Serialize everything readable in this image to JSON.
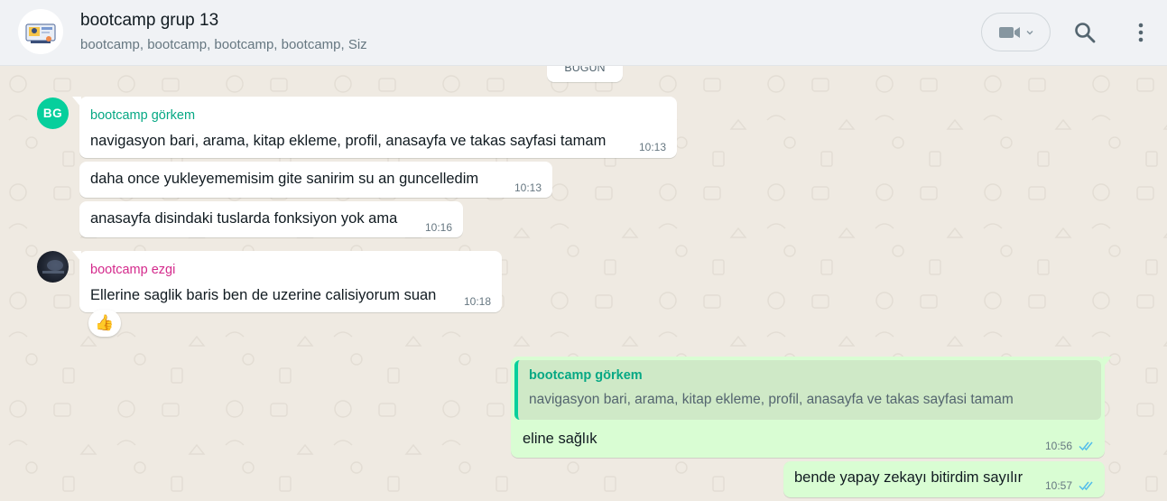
{
  "header": {
    "title": "bootcamp grup 13",
    "members": "bootcamp, bootcamp, bootcamp, bootcamp, Siz",
    "icons": [
      "group-avatar",
      "video-call-icon",
      "chevron-down-icon",
      "search-icon",
      "menu-icon"
    ]
  },
  "date_divider": "BUGÜN",
  "messages": [
    {
      "sender": "bootcamp görkem",
      "avatar_initials": "BG",
      "text": "navigasyon bari, arama, kitap ekleme, profil, anasayfa ve takas sayfasi tamam",
      "time": "10:13"
    },
    {
      "text": "daha once yukleyememisim gite sanirim su an guncelledim",
      "time": "10:13"
    },
    {
      "text": "anasayfa disindaki tuslarda fonksiyon yok ama",
      "time": "10:16"
    },
    {
      "sender": "bootcamp ezgi",
      "text": "Ellerine saglik baris ben de uzerine calisiyorum suan",
      "time": "10:18",
      "reaction": "👍"
    },
    {
      "quoted_sender": "bootcamp görkem",
      "quoted_text": "navigasyon bari, arama, kitap ekleme, profil, anasayfa ve takas sayfasi tamam",
      "text": "eline sağlık",
      "time": "10:56"
    },
    {
      "text": "bende yapay zekayı bitirdim sayılır",
      "time": "10:57"
    }
  ],
  "colors": {
    "sender_gorkem": "#06a884",
    "sender_ezgi": "#d42a8c",
    "outgoing_bubble": "#d9fdd3",
    "incoming_bubble": "#ffffff",
    "read_ticks": "#53bdeb"
  }
}
